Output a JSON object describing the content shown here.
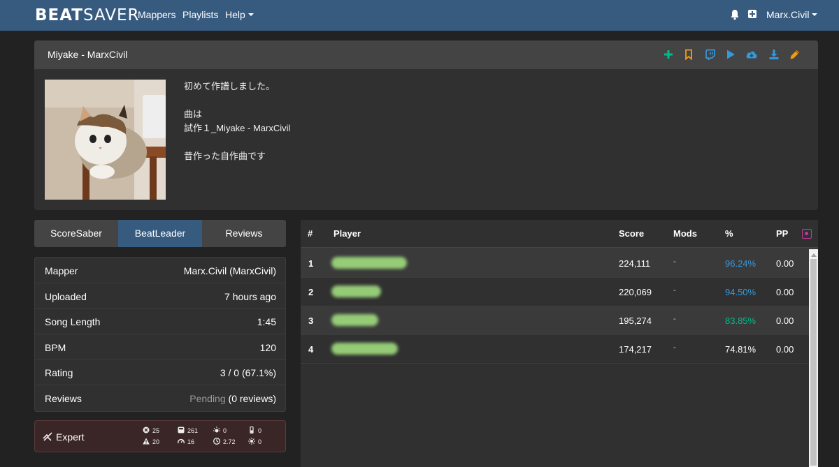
{
  "navbar": {
    "brand_bold": "BEAT",
    "brand_light": "SAVER",
    "links": [
      "Mappers",
      "Playlists",
      "Help"
    ],
    "user": "Marx.Civil"
  },
  "map": {
    "title": "Miyake - MarxCivil",
    "header_icons": [
      "add-to-playlist-icon",
      "bookmark-icon",
      "twitch-icon",
      "play-preview-icon",
      "one-click-install-icon",
      "download-icon",
      "edit-icon"
    ],
    "description": [
      "初めて作譜しました。",
      "",
      "曲は",
      "試作１_Miyake - MarxCivil",
      "",
      "昔作った自作曲です"
    ]
  },
  "tabs": [
    "ScoreSaber",
    "BeatLeader",
    "Reviews"
  ],
  "active_tab": "BeatLeader",
  "info": [
    {
      "key": "Mapper",
      "value": "Marx.Civil (MarxCivil)"
    },
    {
      "key": "Uploaded",
      "value": "7 hours ago"
    },
    {
      "key": "Song Length",
      "value": "1:45"
    },
    {
      "key": "BPM",
      "value": "120"
    },
    {
      "key": "Rating",
      "value": "3 / 0 (67.1%)"
    },
    {
      "key": "Reviews",
      "value_muted": "Pending",
      "value": "(0 reviews)"
    }
  ],
  "difficulty": {
    "name": "Expert",
    "color": "#3a2626",
    "stats": [
      {
        "icon": "bomb-icon",
        "value": "25"
      },
      {
        "icon": "warning-icon",
        "value": "20"
      },
      {
        "icon": "notes-icon",
        "value": "261"
      },
      {
        "icon": "njs-icon",
        "value": "16"
      },
      {
        "icon": "lights-icon",
        "value": "0"
      },
      {
        "icon": "nps-icon",
        "value": "2.72"
      },
      {
        "icon": "walls-icon",
        "value": "0"
      },
      {
        "icon": "events-icon",
        "value": "0"
      }
    ]
  },
  "leaderboard": {
    "columns": [
      "#",
      "Player",
      "Score",
      "Mods",
      "%",
      "PP"
    ],
    "rows": [
      {
        "rank": "1",
        "score": "224,111",
        "mods": "-",
        "percent": "96.24%",
        "pp": "0.00",
        "percent_color": "#3498db"
      },
      {
        "rank": "2",
        "score": "220,069",
        "mods": "-",
        "percent": "94.50%",
        "pp": "0.00",
        "percent_color": "#3498db"
      },
      {
        "rank": "3",
        "score": "195,274",
        "mods": "-",
        "percent": "83.85%",
        "pp": "0.00",
        "percent_color": "#00bc8c"
      },
      {
        "rank": "4",
        "score": "174,217",
        "mods": "-",
        "percent": "74.81%",
        "pp": "0.00",
        "percent_color": "#ffffff"
      }
    ]
  }
}
